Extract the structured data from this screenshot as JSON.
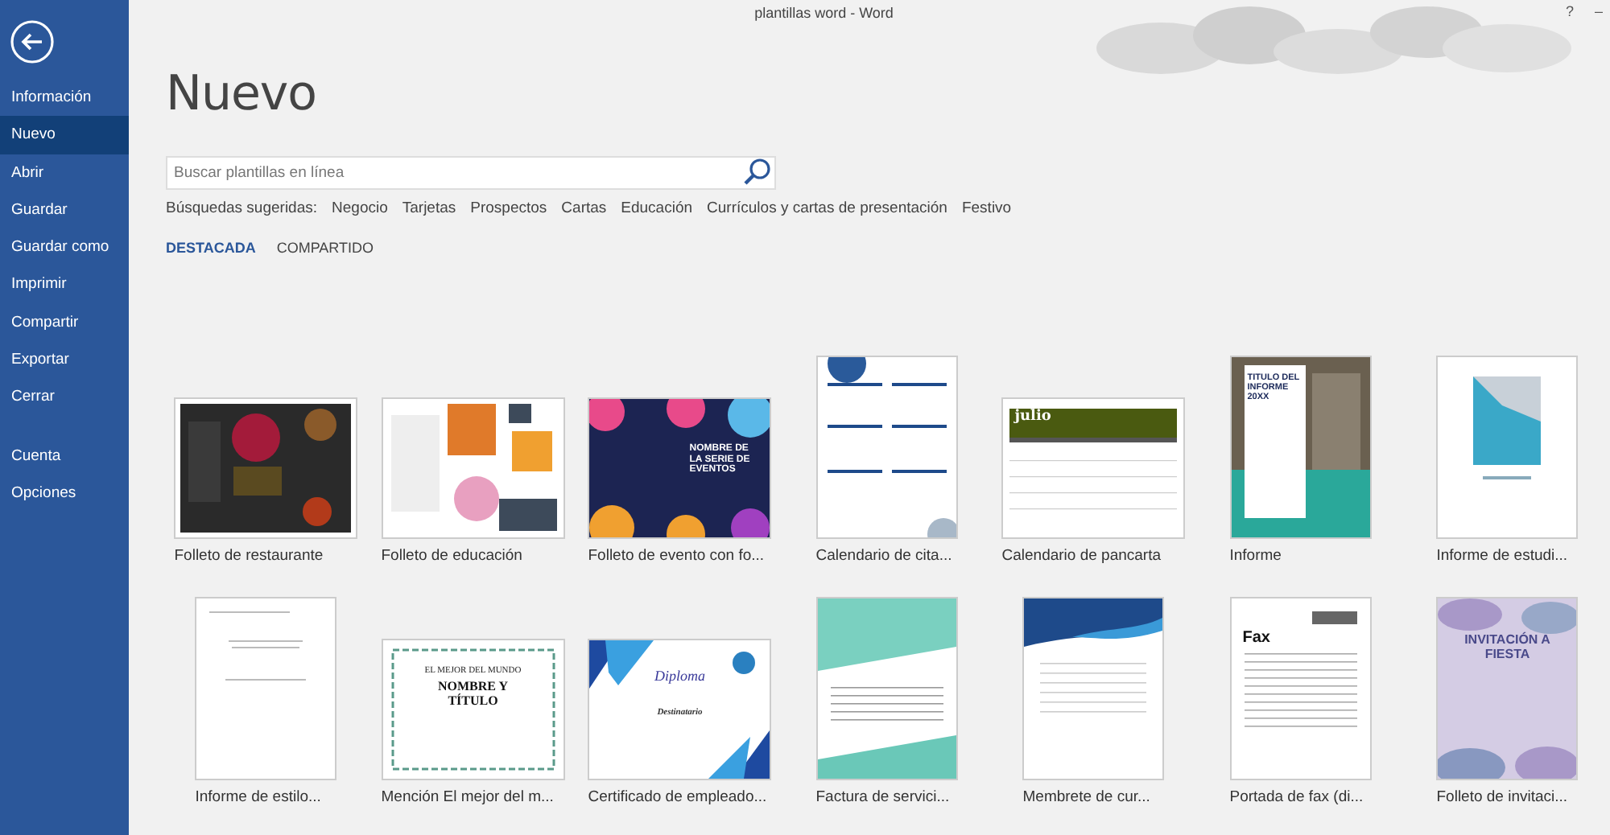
{
  "window": {
    "title": "plantillas word - Word",
    "help": "?",
    "minimize": "–"
  },
  "sidebar": {
    "items": [
      {
        "label": "Información",
        "selected": false
      },
      {
        "label": "Nuevo",
        "selected": true
      },
      {
        "label": "Abrir",
        "selected": false
      },
      {
        "label": "Guardar",
        "selected": false
      },
      {
        "label": "Guardar como",
        "selected": false
      },
      {
        "label": "Imprimir",
        "selected": false
      },
      {
        "label": "Compartir",
        "selected": false
      },
      {
        "label": "Exportar",
        "selected": false
      },
      {
        "label": "Cerrar",
        "selected": false
      }
    ],
    "footer_items": [
      {
        "label": "Cuenta",
        "selected": false
      },
      {
        "label": "Opciones",
        "selected": false
      }
    ]
  },
  "heading": "Nuevo",
  "search": {
    "placeholder": "Buscar plantillas en línea"
  },
  "suggested": {
    "label": "Búsquedas sugeridas:",
    "links": [
      "Negocio",
      "Tarjetas",
      "Prospectos",
      "Cartas",
      "Educación",
      "Currículos y cartas de presentación",
      "Festivo"
    ]
  },
  "tabs": [
    {
      "label": "DESTACADA",
      "selected": true
    },
    {
      "label": "COMPARTIDO",
      "selected": false
    }
  ],
  "templates": [
    [
      {
        "name": "Folleto de restaurante",
        "kind": "restaurant"
      },
      {
        "name": "Folleto de educación",
        "kind": "education"
      },
      {
        "name": "Folleto de evento con fo...",
        "kind": "event",
        "headings": [
          "NOMBRE DE LA SERIE DE EVENTOS"
        ]
      },
      {
        "name": "Calendario de cita...",
        "kind": "appointments"
      },
      {
        "name": "Calendario de pancarta",
        "kind": "banner",
        "headings": [
          "julio"
        ]
      },
      {
        "name": "Informe",
        "kind": "report",
        "headings": [
          "TITULO DEL INFORME 20XX"
        ]
      },
      {
        "name": "Informe de estudi...",
        "kind": "study"
      }
    ],
    [
      {
        "name": "Informe de estilo...",
        "kind": "plain"
      },
      {
        "name": "Mención El mejor del m...",
        "kind": "award",
        "headings": [
          "EL MEJOR DEL MUNDO",
          "NOMBRE Y TÍTULO"
        ]
      },
      {
        "name": "Certificado de empleado...",
        "kind": "diploma",
        "headings": [
          "Diploma",
          "Destinatario"
        ]
      },
      {
        "name": "Factura de servici...",
        "kind": "invoice"
      },
      {
        "name": "Membrete de cur...",
        "kind": "letterhead"
      },
      {
        "name": "Portada de fax (di...",
        "kind": "fax",
        "headings": [
          "Fax"
        ]
      },
      {
        "name": "Folleto de invitaci...",
        "kind": "invitation",
        "headings": [
          "INVITACIÓN A FIESTA"
        ]
      }
    ]
  ]
}
